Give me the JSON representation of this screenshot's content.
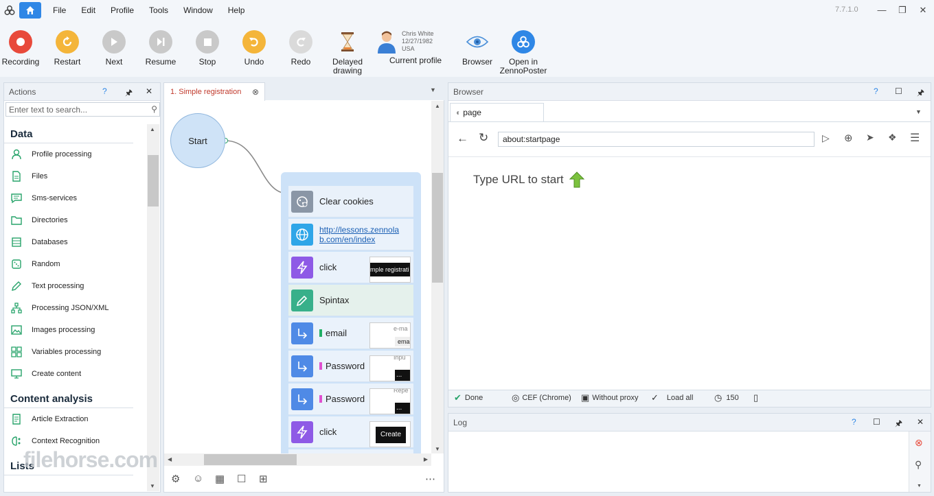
{
  "app": {
    "version": "7.7.1.0"
  },
  "menu": [
    "File",
    "Edit",
    "Profile",
    "Tools",
    "Window",
    "Help"
  ],
  "toolbar": {
    "buttons": [
      {
        "label": "Recording",
        "color": "#e84a3b"
      },
      {
        "label": "Restart",
        "color": "#f4b53a"
      },
      {
        "label": "Next",
        "color": "#c9c9c9"
      },
      {
        "label": "Resume",
        "color": "#c9c9c9"
      },
      {
        "label": "Stop",
        "color": "#c9c9c9"
      },
      {
        "label": "Undo",
        "color": "#f4b53a"
      },
      {
        "label": "Redo",
        "color": "#dadada"
      }
    ],
    "delayed": "Delayed drawing",
    "profile": {
      "name": "Chris White",
      "dob": "12/27/1982",
      "country": "USA",
      "label": "Current profile"
    },
    "browser": "Browser",
    "open": "Open in ZennoPoster"
  },
  "actions": {
    "title": "Actions",
    "search_placeholder": "Enter text to search...",
    "categories": [
      {
        "name": "Data",
        "items": [
          "Profile processing",
          "Files",
          "Sms-services",
          "Directories",
          "Databases",
          "Random",
          "Text processing",
          "Processing JSON/XML",
          "Images processing",
          "Variables processing",
          "Create content"
        ]
      },
      {
        "name": "Content analysis",
        "items": [
          "Article Extraction",
          "Context Recognition"
        ]
      },
      {
        "name": "Lists",
        "items": []
      }
    ]
  },
  "project": {
    "tab": "1. Simple registration",
    "start": "Start",
    "nodes": [
      {
        "label": "Clear cookies",
        "icon": "cookie-icon",
        "color": "#8a96a6"
      },
      {
        "label": "http://lessons.zennolab.com/en/index",
        "line1": "http://lessons.zennola",
        "line2": "b.com/en/index",
        "icon": "globe-icon",
        "color": "#2fa6e8"
      },
      {
        "label": "click",
        "icon": "lightning-icon",
        "color": "#8e5ae6",
        "thumb": "mple registrati"
      },
      {
        "label": "Spintax",
        "icon": "pencil-icon",
        "color": "#38b08a"
      },
      {
        "label": "email",
        "icon": "arrow-icon",
        "color": "#4f8ae6",
        "ind": "#22b066",
        "thumb1": "e-ma",
        "thumb2": "ema"
      },
      {
        "label": "Password",
        "icon": "arrow-icon",
        "color": "#4f8ae6",
        "ind": "#e050d0",
        "thumb1": "Inpu",
        "thumb2": "..."
      },
      {
        "label": "Password",
        "icon": "arrow-icon",
        "color": "#4f8ae6",
        "ind": "#e050d0",
        "thumb1": "Repe",
        "thumb2": "..."
      },
      {
        "label": "click",
        "icon": "lightning-icon",
        "color": "#8e5ae6",
        "thumb": "Create"
      }
    ]
  },
  "browser": {
    "title": "Browser",
    "tab": "page",
    "url": "about:startpage",
    "message": "Type URL to start",
    "status": [
      "Done",
      "CEF (Chrome)",
      "Without proxy",
      "Load all",
      "150"
    ]
  },
  "log": {
    "title": "Log"
  },
  "watermark": "filehorse.com"
}
